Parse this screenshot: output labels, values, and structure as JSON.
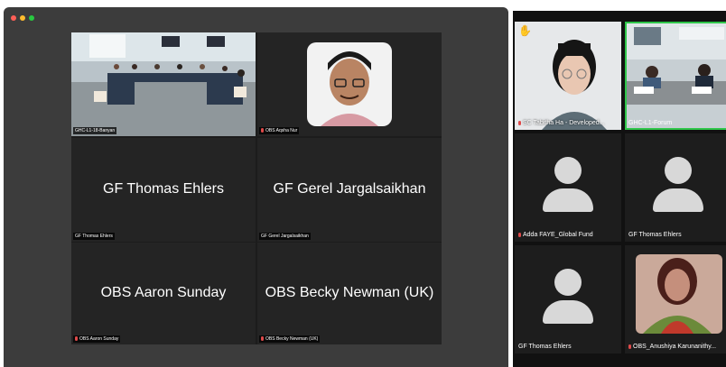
{
  "main_window": {
    "tiles": [
      {
        "label": "GHC-L1-18-Banyan",
        "name": "",
        "mic_muted": false,
        "video": "meeting-room"
      },
      {
        "label": "OBS Aqsha Nur",
        "name": "",
        "mic_muted": true,
        "video": "person-portrait"
      },
      {
        "label": "GF Thomas Ehlers",
        "name": "GF Thomas Ehlers",
        "mic_muted": false
      },
      {
        "label": "GF Gerel Jargalsaikhan",
        "name": "GF Gerel Jargalsaikhan",
        "mic_muted": false
      },
      {
        "label": "OBS Aaron Sunday",
        "name": "OBS Aaron Sunday",
        "mic_muted": true
      },
      {
        "label": "OBS Becky Newman (UK)",
        "name": "OBS Becky Newman (UK)",
        "mic_muted": true
      }
    ]
  },
  "side_gallery": {
    "tiles": [
      {
        "label": "SC Tabitha Ha - Developed...",
        "mic_muted": true,
        "raised_hand": true,
        "video": "person-portrait"
      },
      {
        "label": "GHC-L1-Forum",
        "mic_muted": false,
        "video": "meeting-room"
      },
      {
        "label": "Adda FAYE_Global Fund",
        "mic_muted": true,
        "video": "avatar-placeholder"
      },
      {
        "label": "GF Thomas Ehlers",
        "mic_muted": false,
        "video": "avatar-placeholder"
      },
      {
        "label": "GF Thomas Ehlers",
        "mic_muted": false,
        "video": "avatar-placeholder"
      },
      {
        "label": "OBS_Anushiya Karunanithy...",
        "mic_muted": true,
        "video": "person-portrait"
      }
    ]
  },
  "colors": {
    "active_speaker": "#2fc64a",
    "muted_mic": "#e04a4a",
    "raise_hand": "#f5c343"
  }
}
